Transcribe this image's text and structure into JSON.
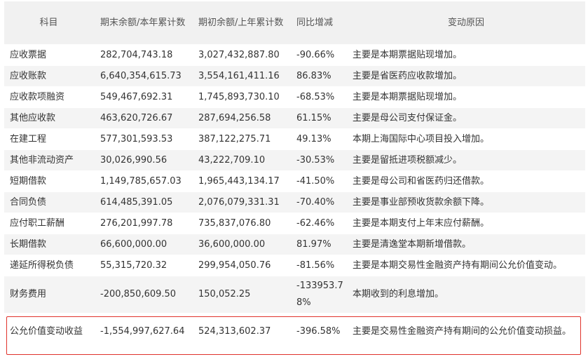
{
  "header": {
    "subject": "科目",
    "closing": "期末余额/本年累计数",
    "opening": "期初余额/上年累计数",
    "yoy": "同比增减",
    "reason": "变动原因"
  },
  "rows": [
    {
      "subject": "应收票据",
      "closing": "282,704,743.18",
      "opening": "3,027,432,887.80",
      "yoy": "-90.66%",
      "reason": "主要是本期票据贴现增加。"
    },
    {
      "subject": "应收账款",
      "closing": "6,640,354,615.73",
      "opening": "3,554,161,411.16",
      "yoy": "86.83%",
      "reason": "主要是省医药应收款增加。"
    },
    {
      "subject": "应收款项融资",
      "closing": "549,467,692.31",
      "opening": "1,745,893,730.10",
      "yoy": "-68.53%",
      "reason": "主要是本期票据贴现增加。"
    },
    {
      "subject": "其他应收款",
      "closing": "463,620,726.67",
      "opening": "287,694,256.58",
      "yoy": "61.15%",
      "reason": "主要是母公司支付保证金。"
    },
    {
      "subject": "在建工程",
      "closing": "577,301,593.53",
      "opening": "387,122,275.71",
      "yoy": "49.13%",
      "reason": "本期上海国际中心项目投入增加。"
    },
    {
      "subject": "其他非流动资产",
      "closing": "30,026,990.56",
      "opening": "43,222,709.10",
      "yoy": "-30.53%",
      "reason": "主要是留抵进项税额减少。"
    },
    {
      "subject": "短期借款",
      "closing": "1,149,785,657.03",
      "opening": "1,965,443,134.17",
      "yoy": "-41.50%",
      "reason": "主要是母公司和省医药归还借款。"
    },
    {
      "subject": "合同负债",
      "closing": "614,485,391.05",
      "opening": "2,076,079,331.31",
      "yoy": "-70.40%",
      "reason": "主要是事业部预收货款余额下降。"
    },
    {
      "subject": "应付职工薪酬",
      "closing": "276,201,997.78",
      "opening": "735,837,076.80",
      "yoy": "-62.46%",
      "reason": "主要是本期支付上年末应付薪酬。"
    },
    {
      "subject": "长期借款",
      "closing": "66,600,000.00",
      "opening": "36,600,000.00",
      "yoy": "81.97%",
      "reason": "主要是清逸堂本期新增借款。"
    },
    {
      "subject": "递延所得税负债",
      "closing": "55,315,720.32",
      "opening": "299,954,050.76",
      "yoy": "-81.56%",
      "reason": "主要是本期交易性金融资产持有期间公允价值变动。"
    },
    {
      "subject": "财务费用",
      "closing": "-200,850,609.50",
      "opening": "150,052.25",
      "yoy": "-133953.78%",
      "reason": "本期收到的利息增加。"
    },
    {
      "subject": "公允价值变动收益",
      "closing": "-1,554,997,627.64",
      "opening": "524,313,602.37",
      "yoy": "-396.58%",
      "reason": "主要是交易性金融资产持有期间的公允价值变动损益。"
    }
  ]
}
